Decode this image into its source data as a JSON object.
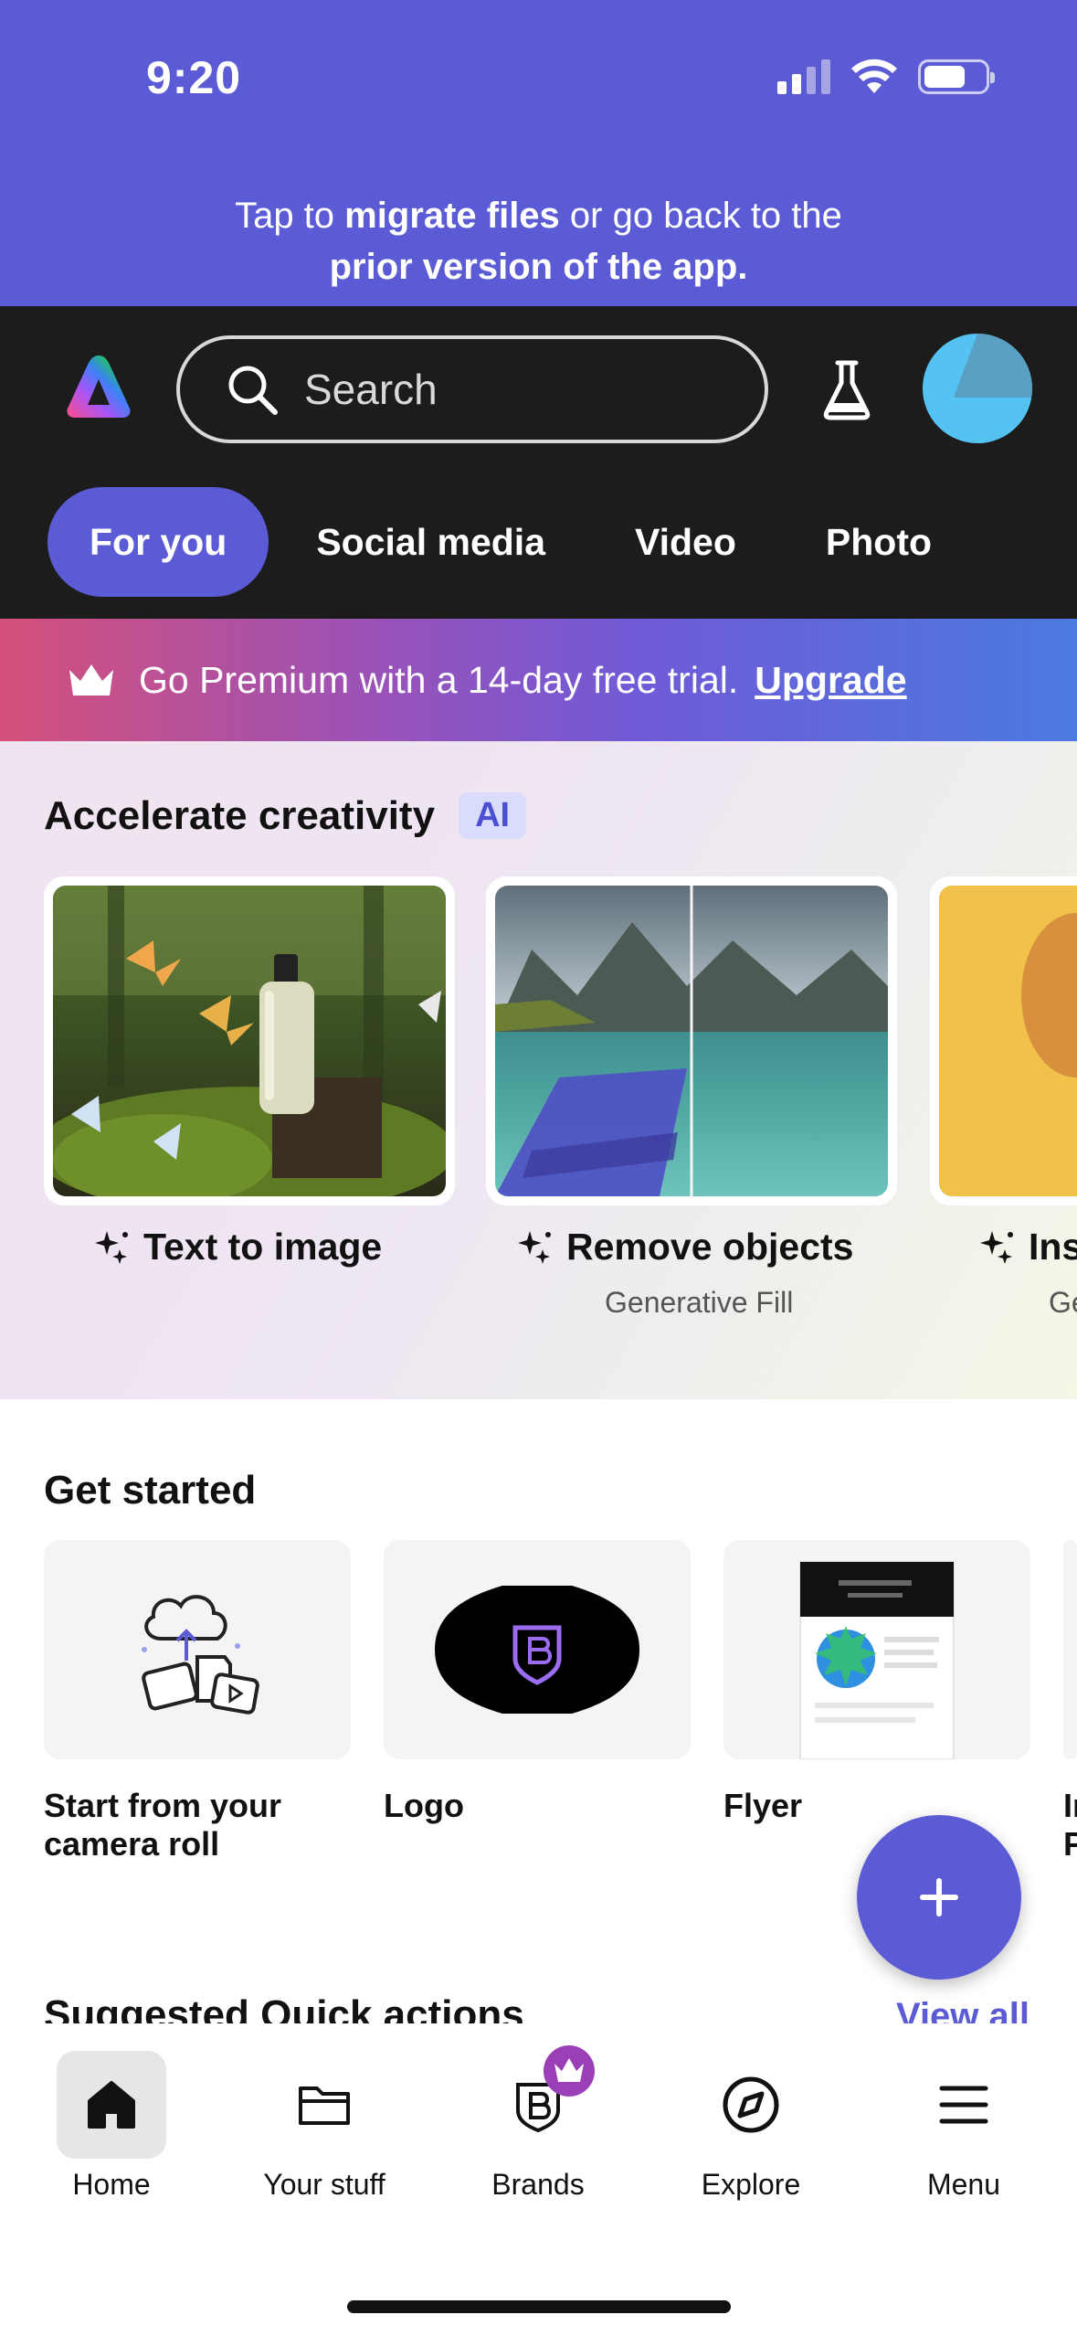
{
  "status_bar": {
    "time": "9:20"
  },
  "migrate_banner": {
    "part1": "Tap to ",
    "bold1": "migrate files",
    "part2": " or go back to the",
    "bold2": "prior version of the app."
  },
  "header": {
    "search_placeholder": "Search",
    "tabs": [
      {
        "label": "For you",
        "active": true
      },
      {
        "label": "Social media",
        "active": false
      },
      {
        "label": "Video",
        "active": false
      },
      {
        "label": "Photo",
        "active": false
      }
    ]
  },
  "premium": {
    "text": "Go Premium with a 14-day free trial.",
    "link": "Upgrade"
  },
  "accelerate": {
    "title": "Accelerate creativity",
    "badge": "AI",
    "cards": [
      {
        "label": "Text to image",
        "sub": ""
      },
      {
        "label": "Remove objects",
        "sub": "Generative Fill"
      },
      {
        "label": "Ins",
        "sub": "Ge"
      }
    ]
  },
  "get_started": {
    "title": "Get started",
    "items": [
      {
        "label": "Start from your camera roll"
      },
      {
        "label": "Logo"
      },
      {
        "label": "Flyer"
      },
      {
        "label": "In P"
      }
    ]
  },
  "quick_actions": {
    "title": "Suggested Quick actions",
    "view_all": "View all"
  },
  "bottom_nav": [
    {
      "label": "Home",
      "active": true
    },
    {
      "label": "Your stuff",
      "active": false
    },
    {
      "label": "Brands",
      "active": false
    },
    {
      "label": "Explore",
      "active": false
    },
    {
      "label": "Menu",
      "active": false
    }
  ],
  "colors": {
    "accent": "#5b5bd6",
    "header_bg": "#1c1c1c",
    "avatar": "#55c3f2"
  }
}
